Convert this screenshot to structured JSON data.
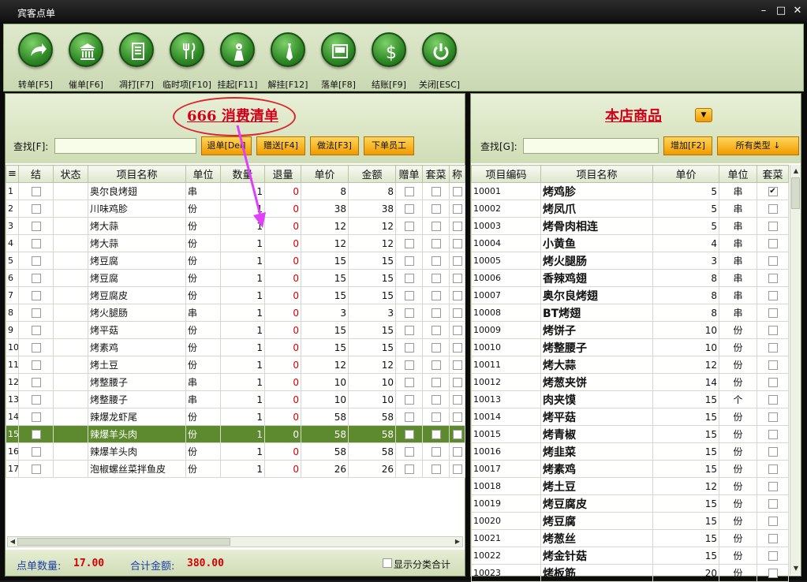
{
  "window": {
    "title": "宾客点单",
    "min": "–",
    "max": "□",
    "close": "✕"
  },
  "toolbar": [
    {
      "label": "转单[F5]",
      "icon": "arrow-right-icon"
    },
    {
      "label": "催单[F6]",
      "icon": "bank-icon"
    },
    {
      "label": "凋打[F7]",
      "icon": "document-icon"
    },
    {
      "label": "临时项[F10]",
      "icon": "utensils-icon"
    },
    {
      "label": "挂起[F11]",
      "icon": "waiter-icon"
    },
    {
      "label": "解挂[F12]",
      "icon": "tie-icon"
    },
    {
      "label": "落单[F8]",
      "icon": "receipt-icon"
    },
    {
      "label": "结账[F9]",
      "icon": "dollar-icon"
    },
    {
      "label": "关闭[ESC]",
      "icon": "power-icon"
    }
  ],
  "left": {
    "title": "666  消费清单",
    "search_label": "查找[F]:",
    "search_value": "",
    "buttons": [
      "退单[Del]",
      "赠送[F4]",
      "做法[F3]",
      "下单员工"
    ],
    "columns": [
      "结",
      "状态",
      "项目名称",
      "单位",
      "数量",
      "退量",
      "单价",
      "金额",
      "赠单",
      "套菜",
      "称"
    ],
    "rows": [
      {
        "n": "1",
        "name": "奥尔良烤翅",
        "unit": "串",
        "qty": "1",
        "ret": "0",
        "price": "8",
        "amt": "8"
      },
      {
        "n": "2",
        "name": "川味鸡胗",
        "unit": "份",
        "qty": "1",
        "ret": "0",
        "price": "38",
        "amt": "38"
      },
      {
        "n": "3",
        "name": "烤大蒜",
        "unit": "份",
        "qty": "1",
        "ret": "0",
        "price": "12",
        "amt": "12"
      },
      {
        "n": "4",
        "name": "烤大蒜",
        "unit": "份",
        "qty": "1",
        "ret": "0",
        "price": "12",
        "amt": "12"
      },
      {
        "n": "5",
        "name": "烤豆腐",
        "unit": "份",
        "qty": "1",
        "ret": "0",
        "price": "15",
        "amt": "15"
      },
      {
        "n": "6",
        "name": "烤豆腐",
        "unit": "份",
        "qty": "1",
        "ret": "0",
        "price": "15",
        "amt": "15"
      },
      {
        "n": "7",
        "name": "烤豆腐皮",
        "unit": "份",
        "qty": "1",
        "ret": "0",
        "price": "15",
        "amt": "15"
      },
      {
        "n": "8",
        "name": "烤火腿肠",
        "unit": "串",
        "qty": "1",
        "ret": "0",
        "price": "3",
        "amt": "3"
      },
      {
        "n": "9",
        "name": "烤平菇",
        "unit": "份",
        "qty": "1",
        "ret": "0",
        "price": "15",
        "amt": "15"
      },
      {
        "n": "10",
        "name": "烤素鸡",
        "unit": "份",
        "qty": "1",
        "ret": "0",
        "price": "15",
        "amt": "15"
      },
      {
        "n": "11",
        "name": "烤土豆",
        "unit": "份",
        "qty": "1",
        "ret": "0",
        "price": "12",
        "amt": "12"
      },
      {
        "n": "12",
        "name": "烤整腰子",
        "unit": "串",
        "qty": "1",
        "ret": "0",
        "price": "10",
        "amt": "10"
      },
      {
        "n": "13",
        "name": "烤整腰子",
        "unit": "串",
        "qty": "1",
        "ret": "0",
        "price": "10",
        "amt": "10"
      },
      {
        "n": "14",
        "name": "辣爆龙虾尾",
        "unit": "份",
        "qty": "1",
        "ret": "0",
        "price": "58",
        "amt": "58"
      },
      {
        "n": "15",
        "name": "辣爆羊头肉",
        "unit": "份",
        "qty": "1",
        "ret": "0",
        "price": "58",
        "amt": "58",
        "selected": true
      },
      {
        "n": "16",
        "name": "辣爆羊头肉",
        "unit": "份",
        "qty": "1",
        "ret": "0",
        "price": "58",
        "amt": "58"
      },
      {
        "n": "17",
        "name": "泡椒螺丝菜拌鱼皮",
        "unit": "份",
        "qty": "1",
        "ret": "0",
        "price": "26",
        "amt": "26"
      }
    ],
    "footer": {
      "count_label": "点单数量:",
      "count": "17.00",
      "total_label": "合计金额:",
      "total": "380.00",
      "toggle_label": "显示分类合计"
    }
  },
  "right": {
    "title": "本店商品",
    "search_label": "查找[G]:",
    "search_value": "",
    "add_button": "增加[F2]",
    "type_button": "所有类型 ↓",
    "columns": [
      "项目编码",
      "项目名称",
      "单价",
      "单位",
      "套菜"
    ],
    "rows": [
      {
        "code": "10001",
        "name": "烤鸡胗",
        "price": "5",
        "unit": "串",
        "set": true
      },
      {
        "code": "10002",
        "name": "烤凤爪",
        "price": "5",
        "unit": "串"
      },
      {
        "code": "10003",
        "name": "烤骨肉相连",
        "price": "5",
        "unit": "串"
      },
      {
        "code": "10004",
        "name": "小黄鱼",
        "price": "4",
        "unit": "串"
      },
      {
        "code": "10005",
        "name": "烤火腿肠",
        "price": "3",
        "unit": "串"
      },
      {
        "code": "10006",
        "name": "香辣鸡翅",
        "price": "8",
        "unit": "串"
      },
      {
        "code": "10007",
        "name": "奥尔良烤翅",
        "price": "8",
        "unit": "串"
      },
      {
        "code": "10008",
        "name": "BT烤翅",
        "price": "8",
        "unit": "串"
      },
      {
        "code": "10009",
        "name": "烤饼子",
        "price": "10",
        "unit": "份"
      },
      {
        "code": "10010",
        "name": "烤整腰子",
        "price": "10",
        "unit": "份"
      },
      {
        "code": "10011",
        "name": "烤大蒜",
        "price": "12",
        "unit": "份"
      },
      {
        "code": "10012",
        "name": "烤葱夹饼",
        "price": "14",
        "unit": "份"
      },
      {
        "code": "10013",
        "name": "肉夹馍",
        "price": "15",
        "unit": "个"
      },
      {
        "code": "10014",
        "name": "烤平菇",
        "price": "15",
        "unit": "份"
      },
      {
        "code": "10015",
        "name": "烤青椒",
        "price": "15",
        "unit": "份"
      },
      {
        "code": "10016",
        "name": "烤韭菜",
        "price": "15",
        "unit": "份"
      },
      {
        "code": "10017",
        "name": "烤素鸡",
        "price": "15",
        "unit": "份"
      },
      {
        "code": "10018",
        "name": "烤土豆",
        "price": "12",
        "unit": "份"
      },
      {
        "code": "10019",
        "name": "烤豆腐皮",
        "price": "15",
        "unit": "份"
      },
      {
        "code": "10020",
        "name": "烤豆腐",
        "price": "15",
        "unit": "份"
      },
      {
        "code": "10021",
        "name": "烤葱丝",
        "price": "15",
        "unit": "份"
      },
      {
        "code": "10022",
        "name": "烤金针菇",
        "price": "15",
        "unit": "份"
      },
      {
        "code": "10023",
        "name": "烤板筋",
        "price": "20",
        "unit": "份"
      }
    ]
  },
  "colors": {
    "accent": "#d4001a",
    "selected_row": "#5d8a2e",
    "button": "#f5b21a",
    "icon_green": "#2e8a26"
  }
}
